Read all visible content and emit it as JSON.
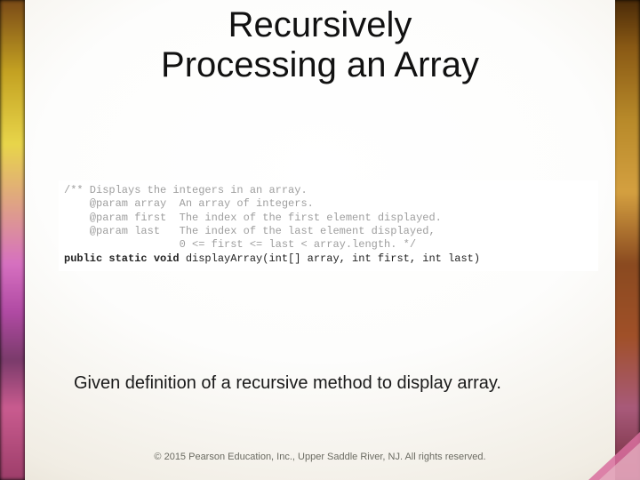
{
  "title_line1": "Recursively",
  "title_line2": "Processing an Array",
  "code": {
    "l1": "/** Displays the integers in an array.",
    "l2": "    @param array  An array of integers.",
    "l3": "    @param first  The index of the first element displayed.",
    "l4": "    @param last   The index of the last element displayed,",
    "l5": "                  0 <= first <= last < array.length. */",
    "sig_kw": "public static void",
    "sig_rest": " displayArray(int[] array, int first, int last)"
  },
  "description": "Given definition of a recursive method to display array.",
  "copyright": "© 2015 Pearson Education, Inc., Upper Saddle River, NJ.  All rights reserved."
}
